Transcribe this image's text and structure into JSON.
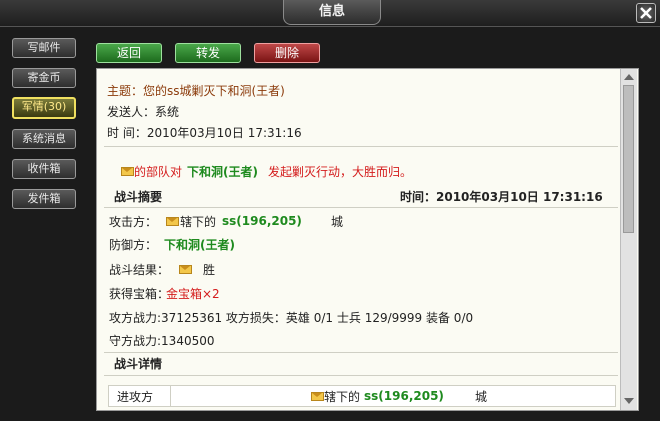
{
  "window": {
    "title": "信息"
  },
  "sidebar": {
    "items": [
      {
        "label": "写邮件"
      },
      {
        "label": "寄金币"
      },
      {
        "label": "军情(30)"
      },
      {
        "label": "系统消息"
      },
      {
        "label": "收件箱"
      },
      {
        "label": "发件箱"
      }
    ]
  },
  "toolbar": {
    "back_label": "返回",
    "forward_label": "转发",
    "delete_label": "删除"
  },
  "message": {
    "subject": "主题：您的ss城剿灭下和洞(王者)",
    "sender": "发送人：系统",
    "time": "时   间：2010年03月10日  17:31:16",
    "headline": {
      "prefix": "的部队对",
      "target": "下和洞(王者)",
      "suffix": "发起剿灭行动，大胜而归。"
    },
    "summary": {
      "title": "战斗摘要",
      "time": "时间：2010年03月10日  17:31:16"
    },
    "attacker_label": "攻击方：",
    "attacker_name": "辖下的",
    "attacker_coord": "ss(196,205)",
    "attacker_suffix": "城",
    "defender_label": "防御方：",
    "defender_name": "下和洞(王者)",
    "result_label": "战斗结果：",
    "result_value": "胜",
    "chest_label": "获得宝箱：",
    "chest_value": "金宝箱×2",
    "attack_stats": "攻方战力:37125361 攻方损失：英雄  0/1 士兵  129/9999 装备  0/0",
    "defense_power": "守方战力:1340500",
    "details_title": "战斗详情",
    "details_row": {
      "label": "进攻方",
      "name": "辖下的",
      "coord": "ss(196,205)",
      "suffix": "城"
    }
  },
  "icons": [
    "close-icon",
    "envelope-icon",
    "scroll-up-icon",
    "scroll-down-icon"
  ]
}
